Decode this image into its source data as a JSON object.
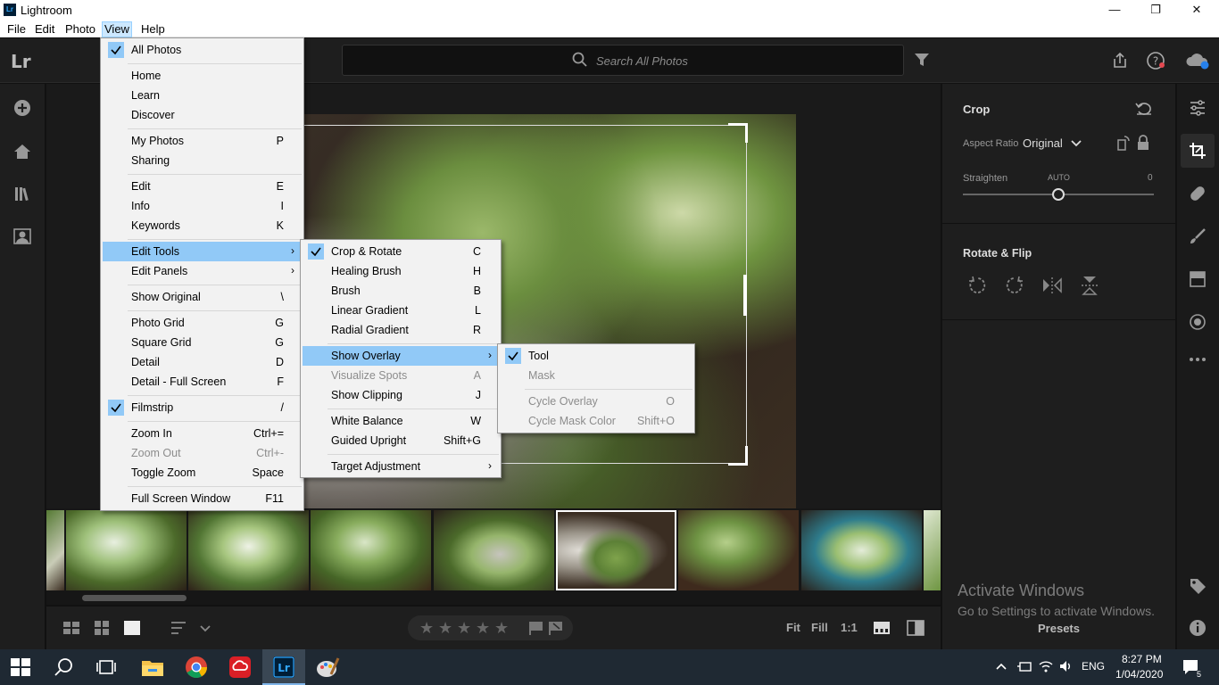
{
  "window": {
    "title": "Lightroom",
    "logo_text": "Lr"
  },
  "menubar": {
    "items": [
      "File",
      "Edit",
      "Photo",
      "View",
      "Help"
    ]
  },
  "search": {
    "placeholder": "Search All Photos"
  },
  "view_menu": {
    "items": [
      {
        "label": "All Photos",
        "shortcut": "",
        "checked": true
      },
      {
        "label": "Home",
        "shortcut": ""
      },
      {
        "label": "Learn",
        "shortcut": ""
      },
      {
        "label": "Discover",
        "shortcut": ""
      },
      {
        "label": "My Photos",
        "shortcut": "P"
      },
      {
        "label": "Sharing",
        "shortcut": ""
      },
      {
        "label": "Edit",
        "shortcut": "E"
      },
      {
        "label": "Info",
        "shortcut": "I"
      },
      {
        "label": "Keywords",
        "shortcut": "K"
      },
      {
        "label": "Edit Tools",
        "shortcut": "",
        "submenu": true,
        "highlighted": true
      },
      {
        "label": "Edit Panels",
        "shortcut": "",
        "submenu": true
      },
      {
        "label": "Show Original",
        "shortcut": "\\"
      },
      {
        "label": "Photo Grid",
        "shortcut": "G"
      },
      {
        "label": "Square Grid",
        "shortcut": "G"
      },
      {
        "label": "Detail",
        "shortcut": "D"
      },
      {
        "label": "Detail - Full Screen",
        "shortcut": "F"
      },
      {
        "label": "Filmstrip",
        "shortcut": "/",
        "checked": true
      },
      {
        "label": "Zoom In",
        "shortcut": "Ctrl+="
      },
      {
        "label": "Zoom Out",
        "shortcut": "Ctrl+-",
        "disabled": true
      },
      {
        "label": "Toggle Zoom",
        "shortcut": "Space"
      },
      {
        "label": "Full Screen Window",
        "shortcut": "F11"
      }
    ]
  },
  "edit_tools_menu": {
    "items": [
      {
        "label": "Crop & Rotate",
        "shortcut": "C",
        "checked": true
      },
      {
        "label": "Healing Brush",
        "shortcut": "H"
      },
      {
        "label": "Brush",
        "shortcut": "B"
      },
      {
        "label": "Linear Gradient",
        "shortcut": "L"
      },
      {
        "label": "Radial Gradient",
        "shortcut": "R"
      },
      {
        "label": "Show Overlay",
        "shortcut": "",
        "submenu": true,
        "highlighted": true
      },
      {
        "label": "Visualize Spots",
        "shortcut": "A",
        "disabled": true
      },
      {
        "label": "Show Clipping",
        "shortcut": "J"
      },
      {
        "label": "White Balance",
        "shortcut": "W"
      },
      {
        "label": "Guided Upright",
        "shortcut": "Shift+G"
      },
      {
        "label": "Target Adjustment",
        "shortcut": "",
        "submenu": true
      }
    ]
  },
  "overlay_menu": {
    "items": [
      {
        "label": "Tool",
        "shortcut": "",
        "checked": true
      },
      {
        "label": "Mask",
        "shortcut": "",
        "disabled": true
      },
      {
        "label": "Cycle Overlay",
        "shortcut": "O",
        "disabled": true
      },
      {
        "label": "Cycle Mask Color",
        "shortcut": "Shift+O",
        "disabled": true
      }
    ]
  },
  "crop_panel": {
    "title": "Crop",
    "aspect_label": "Aspect Ratio",
    "aspect_value": "Original",
    "straighten_label": "Straighten",
    "straighten_auto": "AUTO",
    "straighten_value": "0",
    "straighten_level": 0.5
  },
  "rotate_panel": {
    "title": "Rotate & Flip"
  },
  "bottombar": {
    "zoom_fit": "Fit",
    "zoom_fill": "Fill",
    "zoom_1to1": "1:1",
    "star_glyph": "★"
  },
  "watermark": {
    "line1": "Activate Windows",
    "line2": "Go to Settings to activate Windows."
  },
  "presets_label": "Presets",
  "taskbar": {
    "lang": "ENG",
    "time": "8:27 PM",
    "date": "1/04/2020",
    "notif_count": "5"
  },
  "colors": {
    "accent": "#31a8ff",
    "menu_highlight": "#91c9f7",
    "panel_bg": "#1e1e1e"
  }
}
